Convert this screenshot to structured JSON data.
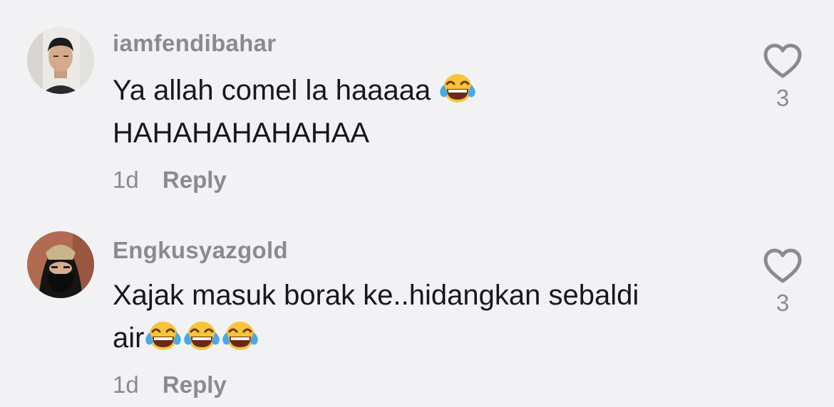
{
  "comments": [
    {
      "username": "iamfendibahar",
      "line1": "Ya allah comel la haaaaa",
      "line2": "HAHAHAHAHAHAA",
      "time": "1d",
      "reply_label": "Reply",
      "like_count": "3",
      "emoji": "face-with-tears-of-joy"
    },
    {
      "username": "Engkusyazgold",
      "line1": "Xajak masuk borak ke..hidangkan sebaldi",
      "line2": "air",
      "time": "1d",
      "reply_label": "Reply",
      "like_count": "3",
      "emoji": "face-with-tears-of-joy"
    }
  ],
  "colors": {
    "background": "#f2f2f5",
    "text": "#16181f",
    "muted": "#8a8b91"
  }
}
